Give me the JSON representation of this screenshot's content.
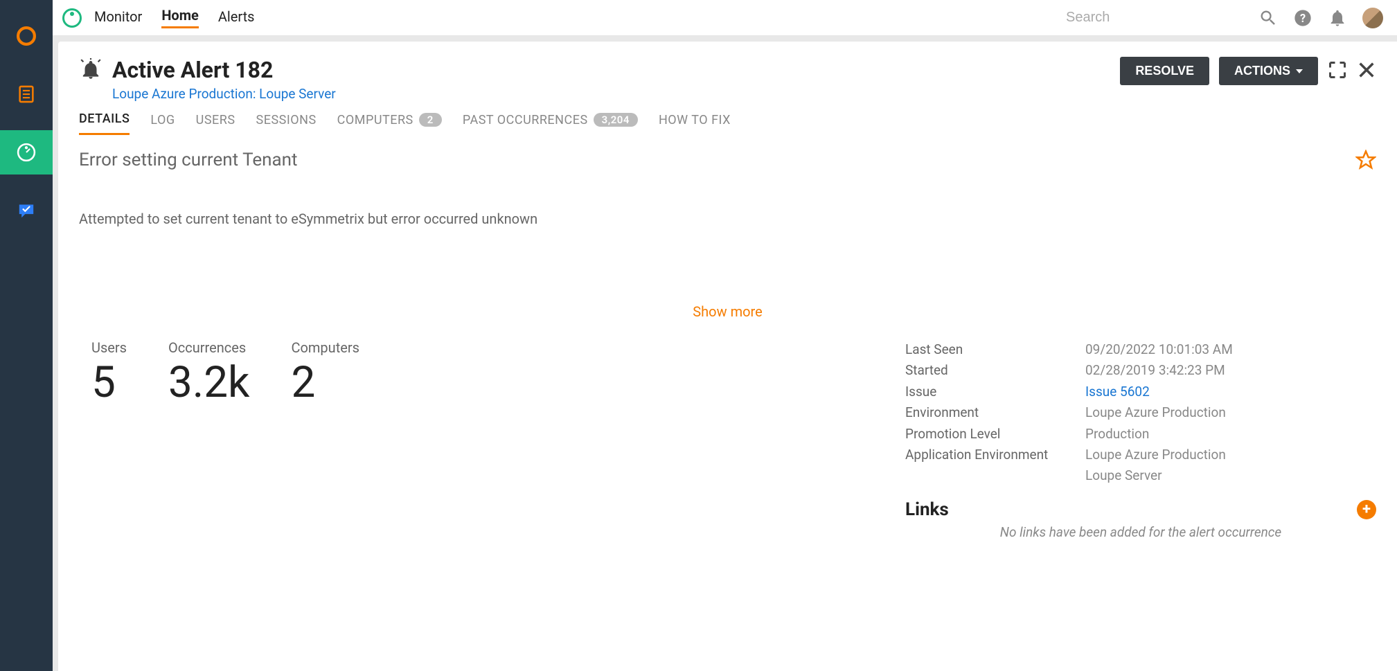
{
  "topnav": {
    "tabs": [
      "Monitor",
      "Home",
      "Alerts"
    ],
    "active": "Home",
    "search_placeholder": "Search"
  },
  "header": {
    "title": "Active Alert 182",
    "subtitle": "Loupe Azure Production: Loupe Server",
    "resolve_label": "RESOLVE",
    "actions_label": "ACTIONS"
  },
  "content_tabs": {
    "items": [
      {
        "label": "DETAILS",
        "badge": null
      },
      {
        "label": "LOG",
        "badge": null
      },
      {
        "label": "USERS",
        "badge": null
      },
      {
        "label": "SESSIONS",
        "badge": null
      },
      {
        "label": "COMPUTERS",
        "badge": "2"
      },
      {
        "label": "PAST OCCURRENCES",
        "badge": "3,204"
      },
      {
        "label": "HOW TO FIX",
        "badge": null
      }
    ],
    "active": "DETAILS"
  },
  "details": {
    "error_title": "Error setting current Tenant",
    "error_desc": "Attempted to set current tenant to eSymmetrix but error occurred unknown",
    "show_more": "Show more",
    "stats": {
      "users": {
        "label": "Users",
        "value": "5"
      },
      "occurrences": {
        "label": "Occurrences",
        "value": "3.2k"
      },
      "computers": {
        "label": "Computers",
        "value": "2"
      }
    },
    "kv": {
      "last_seen": {
        "k": "Last Seen",
        "v": "09/20/2022 10:01:03 AM"
      },
      "started": {
        "k": "Started",
        "v": "02/28/2019 3:42:23 PM"
      },
      "issue": {
        "k": "Issue",
        "v": "Issue 5602"
      },
      "environment": {
        "k": "Environment",
        "v": "Loupe Azure Production"
      },
      "promotion": {
        "k": "Promotion Level",
        "v": "Production"
      },
      "app_env": {
        "k": "Application Environment",
        "v": "Loupe Azure Production"
      },
      "app_env2": "Loupe Server"
    },
    "links": {
      "heading": "Links",
      "empty": "No links have been added for the alert occurrence"
    }
  }
}
